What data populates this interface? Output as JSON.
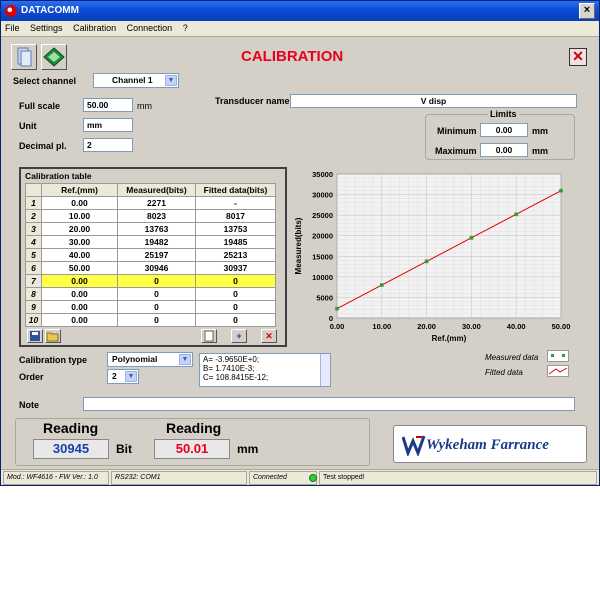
{
  "window": {
    "title": "DATACOMM",
    "close_label": "×"
  },
  "menu": [
    "File",
    "Settings",
    "Calibration",
    "Connection",
    "?"
  ],
  "header": {
    "title": "CALIBRATION",
    "close_label": "✕"
  },
  "channel": {
    "label": "Select channel",
    "value": "Channel 1"
  },
  "left_fields": {
    "full_scale_label": "Full scale",
    "full_scale_value": "50.00",
    "full_scale_unit": "mm",
    "unit_label": "Unit",
    "unit_value": "mm",
    "decimal_label": "Decimal pl.",
    "decimal_value": "2"
  },
  "transducer": {
    "label": "Transducer name",
    "value": "V disp"
  },
  "limits": {
    "title": "Limits",
    "min_label": "Minimum",
    "min_value": "0.00",
    "min_unit": "mm",
    "max_label": "Maximum",
    "max_value": "0.00",
    "max_unit": "mm"
  },
  "table": {
    "title": "Calibration table",
    "headers": [
      "",
      "Ref.(mm)",
      "Measured(bits)",
      "Fitted data(bits)"
    ],
    "rows": [
      [
        "1",
        "0.00",
        "2271",
        "-"
      ],
      [
        "2",
        "10.00",
        "8023",
        "8017"
      ],
      [
        "3",
        "20.00",
        "13763",
        "13753"
      ],
      [
        "4",
        "30.00",
        "19482",
        "19485"
      ],
      [
        "5",
        "40.00",
        "25197",
        "25213"
      ],
      [
        "6",
        "50.00",
        "30946",
        "30937"
      ],
      [
        "7",
        "0.00",
        "0",
        "0"
      ],
      [
        "8",
        "0.00",
        "0",
        "0"
      ],
      [
        "9",
        "0.00",
        "0",
        "0"
      ],
      [
        "10",
        "0.00",
        "0",
        "0"
      ]
    ],
    "highlight_row": 6,
    "buttons": {
      "add": "+",
      "delete": "✕"
    }
  },
  "chart_data": {
    "type": "scatter",
    "xlabel": "Ref.(mm)",
    "ylabel": "Measured(bits)",
    "xlim": [
      0,
      50
    ],
    "ylim": [
      0,
      35000
    ],
    "xticks": [
      "0.00",
      "10.00",
      "20.00",
      "30.00",
      "40.00",
      "50.00"
    ],
    "yticks": [
      "0",
      "5000",
      "10000",
      "15000",
      "20000",
      "25000",
      "30000",
      "35000"
    ],
    "grid": true,
    "series": [
      {
        "name": "Measured data",
        "type": "scatter",
        "color": "#2e9e2e",
        "x": [
          0,
          10,
          20,
          30,
          40,
          50
        ],
        "y": [
          2271,
          8023,
          13763,
          19482,
          25197,
          30946
        ]
      },
      {
        "name": "Fitted data",
        "type": "line",
        "color": "#e00000",
        "x": [
          0,
          10,
          20,
          30,
          40,
          50
        ],
        "y": [
          2271,
          8017,
          13753,
          19485,
          25213,
          30937
        ]
      }
    ]
  },
  "calibration": {
    "type_label": "Calibration type",
    "type_value": "Polynomial",
    "order_label": "Order",
    "order_value": "2",
    "coefficients": [
      "A= -3.9650E+0;",
      "B= 1.7410E-3;",
      "C= 108.8415E-12;"
    ]
  },
  "legend": {
    "measured": "Measured data",
    "fitted": "Fitted data"
  },
  "note": {
    "label": "Note",
    "value": ""
  },
  "readings": {
    "bit_title": "Reading",
    "bit_value": "30945",
    "bit_unit": "Bit",
    "mm_title": "Reading",
    "mm_value": "50.01",
    "mm_unit": "mm"
  },
  "logo": {
    "text": "Wykeham Farrance"
  },
  "status": {
    "model": "Mod.: WF4616 - FW Ver.: 1.0",
    "port": "RS232: COM1",
    "connection": "Connected",
    "message": "Test stopped!",
    "indicator_color": "#33cc33"
  },
  "colors": {
    "title_red": "#e8001c",
    "highlight": "#ffff44",
    "reading_blue": "#1a3fa8",
    "reading_red": "#e8001c"
  }
}
